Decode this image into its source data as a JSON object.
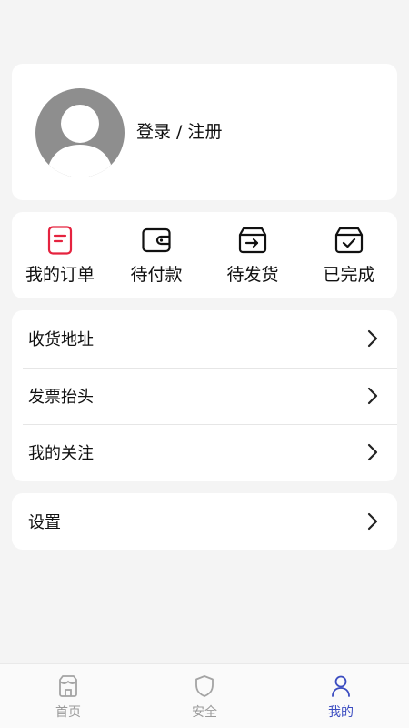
{
  "profile": {
    "login_label": "登录 / 注册"
  },
  "orders": [
    {
      "label": "我的订单",
      "icon": "order-list-icon",
      "color": "#e5233f"
    },
    {
      "label": "待付款",
      "icon": "wallet-icon",
      "color": "#111111"
    },
    {
      "label": "待发货",
      "icon": "shipping-box-icon",
      "color": "#111111"
    },
    {
      "label": "已完成",
      "icon": "completed-box-icon",
      "color": "#111111"
    }
  ],
  "menu": [
    {
      "label": "收货地址"
    },
    {
      "label": "发票抬头"
    },
    {
      "label": "我的关注"
    }
  ],
  "settings": {
    "label": "设置"
  },
  "tabs": [
    {
      "label": "首页",
      "icon": "home-icon",
      "active": false
    },
    {
      "label": "安全",
      "icon": "shield-icon",
      "active": false
    },
    {
      "label": "我的",
      "icon": "user-icon",
      "active": true
    }
  ],
  "colors": {
    "accent": "#3b4cc0",
    "order_highlight": "#e5233f",
    "avatar": "#8e8e8e",
    "background": "#f4f4f4"
  }
}
